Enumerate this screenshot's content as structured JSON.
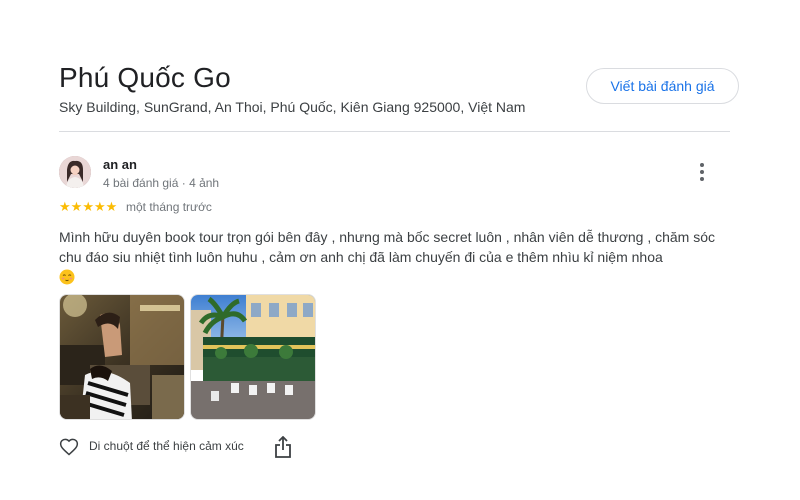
{
  "place": {
    "name": "Phú Quốc Go",
    "address": "Sky Building, SunGrand, An Thoi, Phú Quốc, Kiên Giang 925000, Việt Nam",
    "write_review_label": "Viết bài đánh giá"
  },
  "review": {
    "author": "an an",
    "author_meta": "4 bài đánh giá · 4 ảnh",
    "rating": 5,
    "rating_max": 5,
    "date": "một tháng trước",
    "text": "Mình hữu duyên book tour trọn gói bên đây , nhưng mà bốc secret luôn , nhân viên dễ thương , chăm sóc chu đáo siu nhiệt tình luôn huhu , cảm ơn anh chị đã làm chuyến đi của e thêm nhìu kỉ niệm nhoa",
    "emoji": "smiling-face-icon",
    "photos": [
      "review-photo-1",
      "review-photo-2"
    ],
    "like_hint": "Di chuột để thể hiện cảm xúc"
  },
  "icons": {
    "like": "heart-outline-icon",
    "share": "share-icon",
    "more": "more-vert-icon"
  },
  "colors": {
    "accent": "#1a73e8",
    "star": "#fbbc04",
    "muted_text": "#70757a",
    "divider": "#dadce0"
  }
}
